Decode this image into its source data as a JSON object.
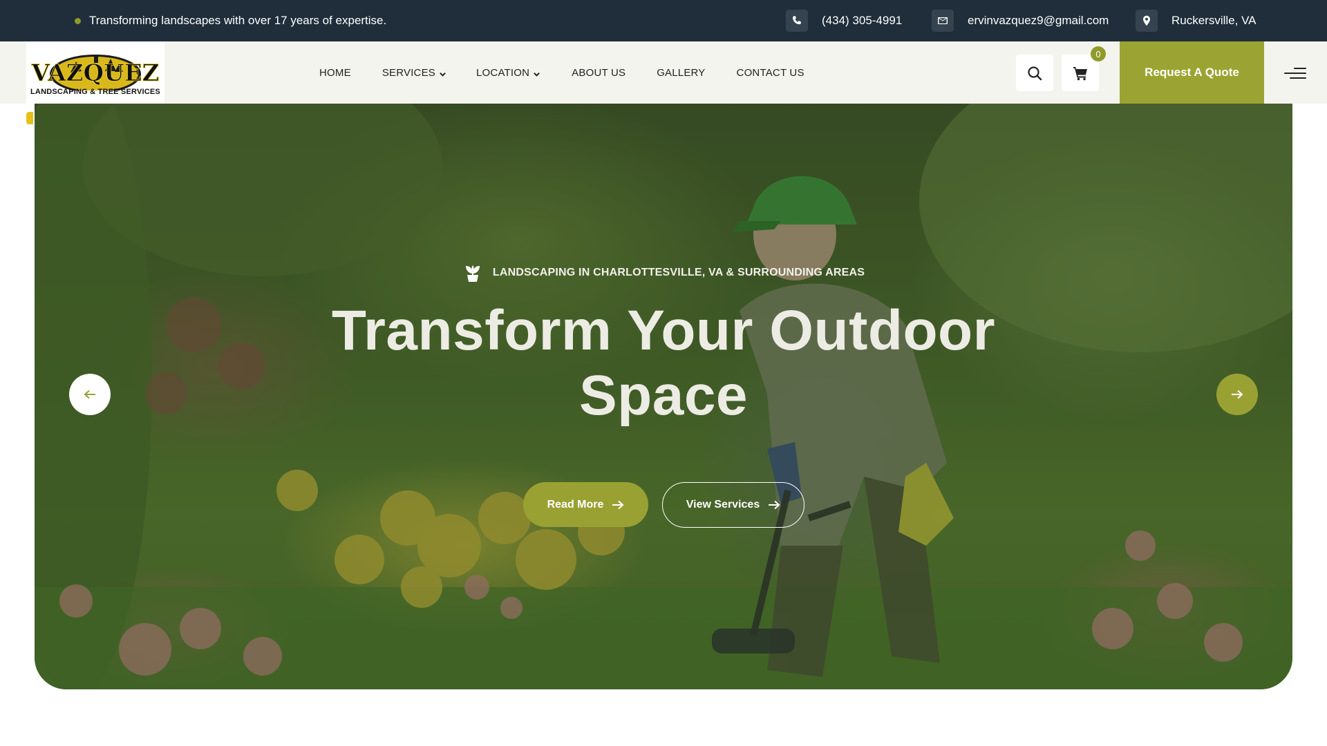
{
  "topbar": {
    "tagline": "Transforming landscapes with over 17 years of expertise.",
    "phone": "(434) 305-4991",
    "email": "ervinvazquez9@gmail.com",
    "location": "Ruckersville, VA",
    "bg_color": "#1f2e3a"
  },
  "brand": {
    "logo_word": "VAZQUEZ",
    "logo_sub": "LANDSCAPING & TREE SERVICES"
  },
  "nav": {
    "items": [
      {
        "label": "HOME",
        "dropdown": false
      },
      {
        "label": "SERVICES",
        "dropdown": true
      },
      {
        "label": "LOCATION",
        "dropdown": true
      },
      {
        "label": "ABOUT US",
        "dropdown": false
      },
      {
        "label": "GALLERY",
        "dropdown": false
      },
      {
        "label": "CONTACT US",
        "dropdown": false
      }
    ],
    "cart_count": "0",
    "quote_label": "Request A Quote",
    "accent_color": "#9ba432"
  },
  "hero": {
    "eyebrow": "LANDSCAPING IN CHARLOTTESVILLE, VA & SURROUNDING AREAS",
    "headline_line1": "Transform Your Outdoor",
    "headline_line2": "Space",
    "cta_primary": "Read More",
    "cta_secondary": "View Services"
  },
  "icons": {
    "phone": "phone-icon",
    "email": "envelope-icon",
    "location": "map-pin-icon",
    "search": "search-icon",
    "cart": "cart-icon",
    "menu": "menu-icon",
    "eyebrow": "plant-icon",
    "prev": "arrow-left-icon",
    "next": "arrow-right-icon"
  }
}
